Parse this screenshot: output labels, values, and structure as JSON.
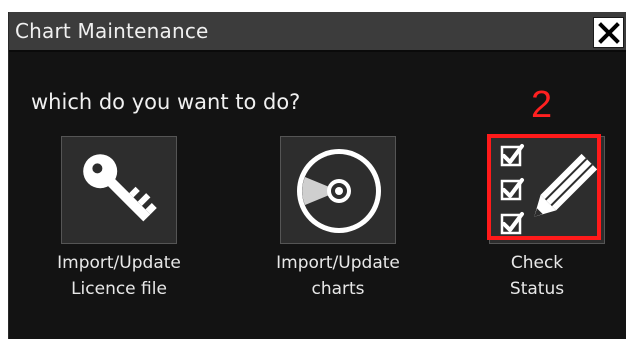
{
  "dialog": {
    "title": "Chart Maintenance",
    "prompt": "which do you want to do?",
    "annotation": "2"
  },
  "options": [
    {
      "line1": "Import/Update",
      "line2": "Licence file",
      "icon": "key-icon"
    },
    {
      "line1": "Import/Update",
      "line2": "charts",
      "icon": "disc-icon"
    },
    {
      "line1": "Check",
      "line2": "Status",
      "icon": "checklist-pencil-icon"
    }
  ],
  "colors": {
    "background": "#131313",
    "titlebar": "#3c3c3c",
    "tile": "#2d2d2d",
    "highlight": "#ff1a1a",
    "text": "#f0f0f0"
  }
}
